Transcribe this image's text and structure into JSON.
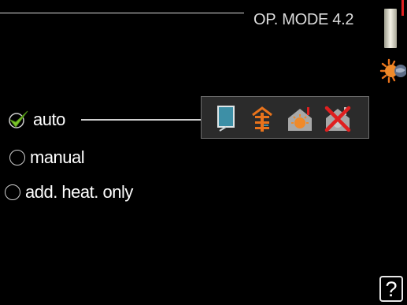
{
  "header": {
    "title": "OP. MODE 4.2"
  },
  "options": [
    {
      "label": "auto",
      "selected": true
    },
    {
      "label": "manual",
      "selected": false
    },
    {
      "label": "add. heat. only",
      "selected": false
    }
  ],
  "mode_icons": [
    "compressor-icon",
    "additional-heat-icon",
    "heating-icon",
    "heating-off-icon"
  ],
  "help": {
    "label": "?"
  },
  "colors": {
    "background": "#000000",
    "check": "#7cc52a",
    "accent_orange": "#e8731c",
    "alert_red": "#e02020",
    "compressor_blue": "#3d8fa6"
  }
}
